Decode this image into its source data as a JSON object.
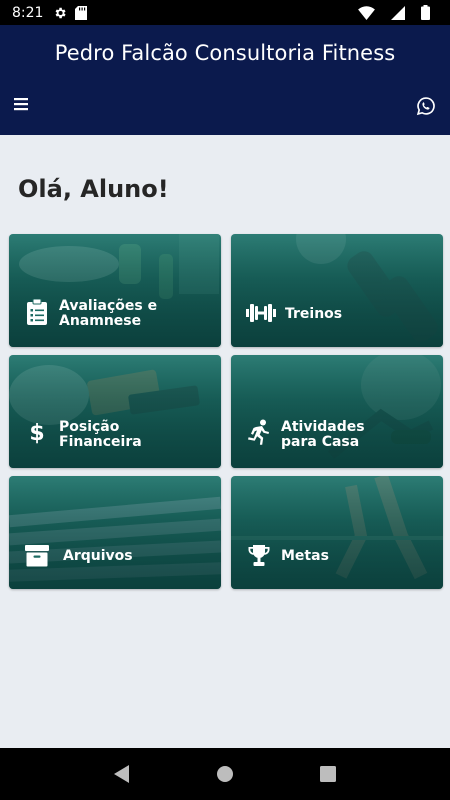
{
  "status_bar": {
    "time": "8:21",
    "icons": [
      "gear-icon",
      "sd-card-icon",
      "wifi-icon",
      "signal-icon",
      "battery-icon"
    ]
  },
  "app_bar": {
    "title": "Pedro Falcão Consultoria Fitness",
    "background": "#0b1a4d",
    "left_icon": "hamburger-menu-icon",
    "right_icon": "whatsapp-icon"
  },
  "main": {
    "greeting": "Olá, Aluno!",
    "tiles": [
      {
        "id": "avaliacoes",
        "line1": "Avaliações e",
        "line2": "Anamnese",
        "icon": "clipboard-list-icon"
      },
      {
        "id": "treinos",
        "line1": "Treinos",
        "line2": "",
        "icon": "dumbbell-icon"
      },
      {
        "id": "posicao",
        "line1": "Posição",
        "line2": "Financeira",
        "icon": "dollar-icon"
      },
      {
        "id": "atividades",
        "line1": "Atividades",
        "line2": "para Casa",
        "icon": "running-icon"
      },
      {
        "id": "arquivos",
        "line1": "Arquivos",
        "line2": "",
        "icon": "archive-box-icon"
      },
      {
        "id": "metas",
        "line1": "Metas",
        "line2": "",
        "icon": "trophy-icon"
      }
    ],
    "tile_color": "#1f6f66"
  },
  "nav_bar": {
    "buttons": [
      "back-icon",
      "home-icon",
      "recents-icon"
    ]
  }
}
